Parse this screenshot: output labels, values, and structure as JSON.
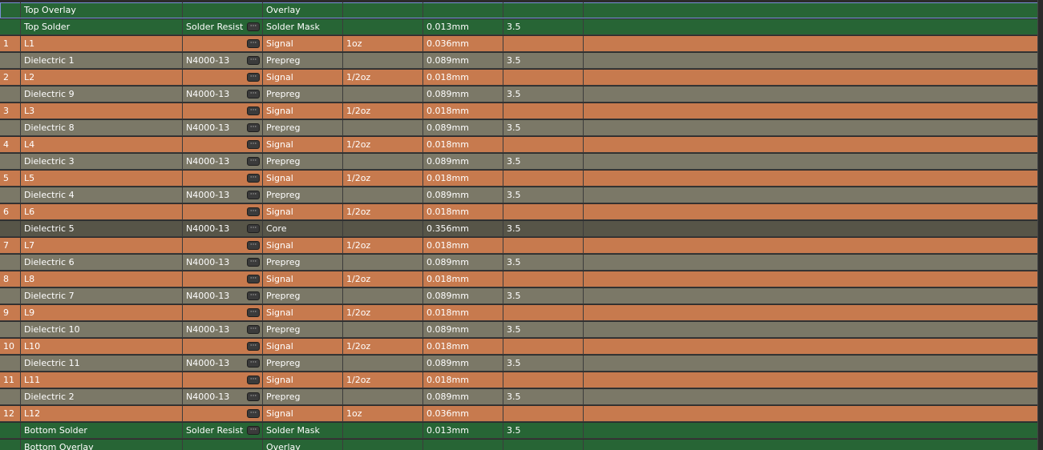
{
  "layers": [
    {
      "kind": "overlay",
      "num": "",
      "name": "Top Overlay",
      "material": "",
      "ellipsis": false,
      "type": "Overlay",
      "weight": "",
      "thickness": "",
      "dk": ""
    },
    {
      "kind": "solder",
      "num": "",
      "name": "Top Solder",
      "material": "Solder Resist",
      "ellipsis": true,
      "type": "Solder Mask",
      "weight": "",
      "thickness": "0.013mm",
      "dk": "3.5"
    },
    {
      "kind": "signal",
      "num": "1",
      "name": "L1",
      "material": "",
      "ellipsis": true,
      "type": "Signal",
      "weight": "1oz",
      "thickness": "0.036mm",
      "dk": ""
    },
    {
      "kind": "prepreg",
      "num": "",
      "name": "Dielectric 1",
      "material": "N4000-13",
      "ellipsis": true,
      "type": "Prepreg",
      "weight": "",
      "thickness": "0.089mm",
      "dk": "3.5"
    },
    {
      "kind": "signal",
      "num": "2",
      "name": "L2",
      "material": "",
      "ellipsis": true,
      "type": "Signal",
      "weight": "1/2oz",
      "thickness": "0.018mm",
      "dk": ""
    },
    {
      "kind": "prepreg",
      "num": "",
      "name": "Dielectric 9",
      "material": "N4000-13",
      "ellipsis": true,
      "type": "Prepreg",
      "weight": "",
      "thickness": "0.089mm",
      "dk": "3.5"
    },
    {
      "kind": "signal",
      "num": "3",
      "name": "L3",
      "material": "",
      "ellipsis": true,
      "type": "Signal",
      "weight": "1/2oz",
      "thickness": "0.018mm",
      "dk": ""
    },
    {
      "kind": "prepreg",
      "num": "",
      "name": "Dielectric 8",
      "material": "N4000-13",
      "ellipsis": true,
      "type": "Prepreg",
      "weight": "",
      "thickness": "0.089mm",
      "dk": "3.5"
    },
    {
      "kind": "signal",
      "num": "4",
      "name": "L4",
      "material": "",
      "ellipsis": true,
      "type": "Signal",
      "weight": "1/2oz",
      "thickness": "0.018mm",
      "dk": ""
    },
    {
      "kind": "prepreg",
      "num": "",
      "name": "Dielectric 3",
      "material": "N4000-13",
      "ellipsis": true,
      "type": "Prepreg",
      "weight": "",
      "thickness": "0.089mm",
      "dk": "3.5"
    },
    {
      "kind": "signal",
      "num": "5",
      "name": "L5",
      "material": "",
      "ellipsis": true,
      "type": "Signal",
      "weight": "1/2oz",
      "thickness": "0.018mm",
      "dk": ""
    },
    {
      "kind": "prepreg",
      "num": "",
      "name": "Dielectric 4",
      "material": "N4000-13",
      "ellipsis": true,
      "type": "Prepreg",
      "weight": "",
      "thickness": "0.089mm",
      "dk": "3.5"
    },
    {
      "kind": "signal",
      "num": "6",
      "name": "L6",
      "material": "",
      "ellipsis": true,
      "type": "Signal",
      "weight": "1/2oz",
      "thickness": "0.018mm",
      "dk": ""
    },
    {
      "kind": "core",
      "num": "",
      "name": "Dielectric 5",
      "material": "N4000-13",
      "ellipsis": true,
      "type": "Core",
      "weight": "",
      "thickness": "0.356mm",
      "dk": "3.5"
    },
    {
      "kind": "signal",
      "num": "7",
      "name": "L7",
      "material": "",
      "ellipsis": true,
      "type": "Signal",
      "weight": "1/2oz",
      "thickness": "0.018mm",
      "dk": ""
    },
    {
      "kind": "prepreg",
      "num": "",
      "name": "Dielectric 6",
      "material": "N4000-13",
      "ellipsis": true,
      "type": "Prepreg",
      "weight": "",
      "thickness": "0.089mm",
      "dk": "3.5"
    },
    {
      "kind": "signal",
      "num": "8",
      "name": "L8",
      "material": "",
      "ellipsis": true,
      "type": "Signal",
      "weight": "1/2oz",
      "thickness": "0.018mm",
      "dk": ""
    },
    {
      "kind": "prepreg",
      "num": "",
      "name": "Dielectric 7",
      "material": "N4000-13",
      "ellipsis": true,
      "type": "Prepreg",
      "weight": "",
      "thickness": "0.089mm",
      "dk": "3.5"
    },
    {
      "kind": "signal",
      "num": "9",
      "name": "L9",
      "material": "",
      "ellipsis": true,
      "type": "Signal",
      "weight": "1/2oz",
      "thickness": "0.018mm",
      "dk": ""
    },
    {
      "kind": "prepreg",
      "num": "",
      "name": "Dielectric 10",
      "material": "N4000-13",
      "ellipsis": true,
      "type": "Prepreg",
      "weight": "",
      "thickness": "0.089mm",
      "dk": "3.5"
    },
    {
      "kind": "signal",
      "num": "10",
      "name": "L10",
      "material": "",
      "ellipsis": true,
      "type": "Signal",
      "weight": "1/2oz",
      "thickness": "0.018mm",
      "dk": ""
    },
    {
      "kind": "prepreg",
      "num": "",
      "name": "Dielectric 11",
      "material": "N4000-13",
      "ellipsis": true,
      "type": "Prepreg",
      "weight": "",
      "thickness": "0.089mm",
      "dk": "3.5"
    },
    {
      "kind": "signal",
      "num": "11",
      "name": "L11",
      "material": "",
      "ellipsis": true,
      "type": "Signal",
      "weight": "1/2oz",
      "thickness": "0.018mm",
      "dk": ""
    },
    {
      "kind": "prepreg",
      "num": "",
      "name": "Dielectric 2",
      "material": "N4000-13",
      "ellipsis": true,
      "type": "Prepreg",
      "weight": "",
      "thickness": "0.089mm",
      "dk": "3.5"
    },
    {
      "kind": "signal",
      "num": "12",
      "name": "L12",
      "material": "",
      "ellipsis": true,
      "type": "Signal",
      "weight": "1oz",
      "thickness": "0.036mm",
      "dk": ""
    },
    {
      "kind": "solder",
      "num": "",
      "name": "Bottom Solder",
      "material": "Solder Resist",
      "ellipsis": true,
      "type": "Solder Mask",
      "weight": "",
      "thickness": "0.013mm",
      "dk": "3.5"
    },
    {
      "kind": "overlay",
      "num": "",
      "name": "Bottom Overlay",
      "material": "",
      "ellipsis": false,
      "type": "Overlay",
      "weight": "",
      "thickness": "",
      "dk": ""
    }
  ],
  "selected_row": 0,
  "ellipsis_glyph": "···",
  "colors": {
    "overlay": "#276535",
    "solder_mask": "#276535",
    "signal": "#c77a4e",
    "prepreg": "#7b7867",
    "core": "#575548",
    "selection_outline": "#7a8fd8"
  }
}
